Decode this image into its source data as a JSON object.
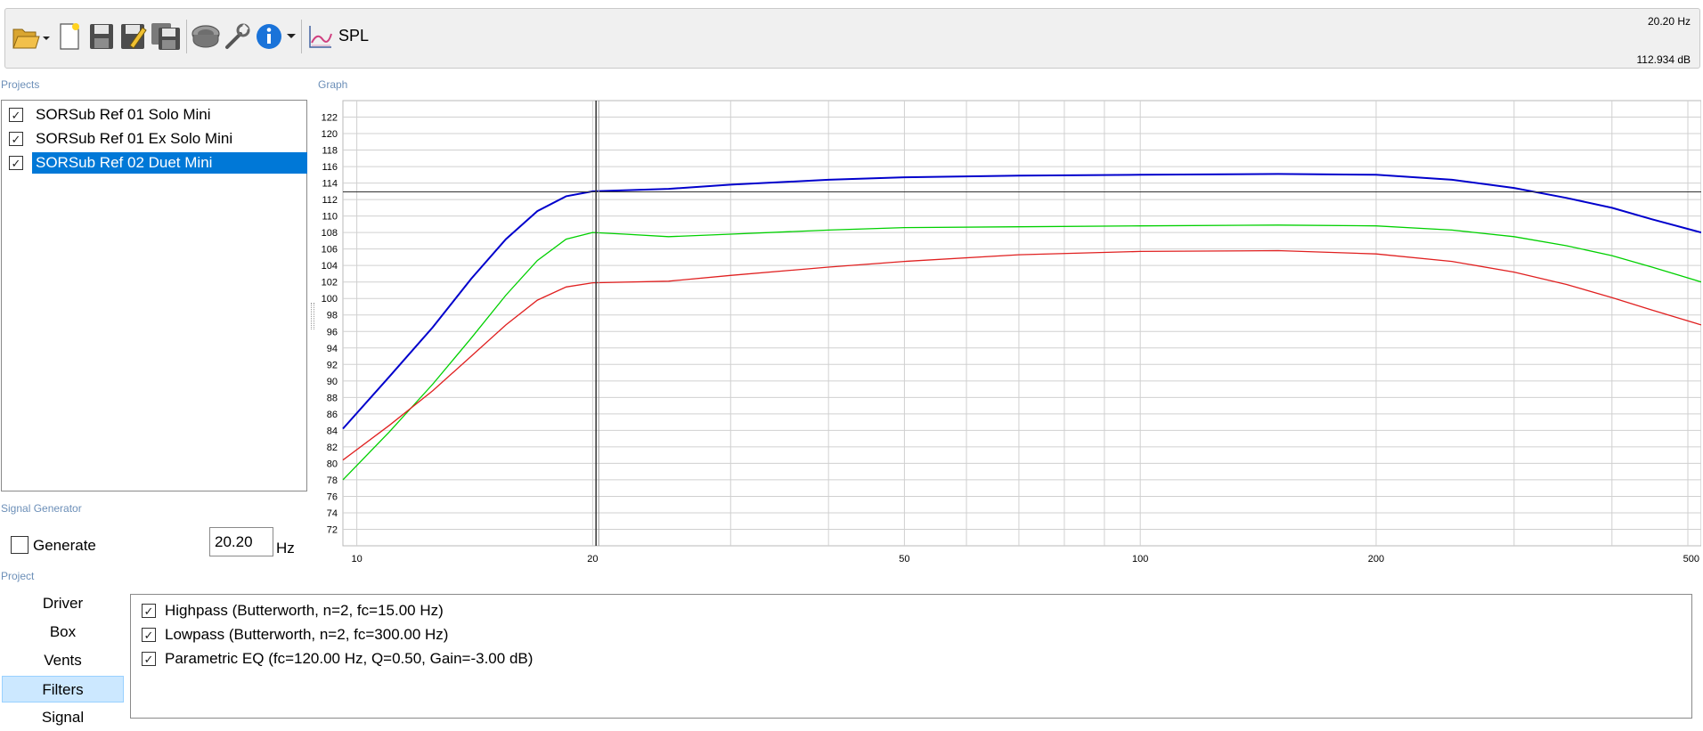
{
  "toolbar": {
    "icons": [
      "folder-open-icon",
      "new-file-icon",
      "save-icon",
      "save-as-icon",
      "save-all-icon",
      "speaker-icon",
      "wrench-icon",
      "info-icon",
      "spl-chart-icon"
    ],
    "spl_label": "SPL",
    "readout_freq": "20.20 Hz",
    "readout_spl": "112.934 dB"
  },
  "projects": {
    "heading": "Projects",
    "items": [
      {
        "label": "SORSub Ref 01 Solo Mini",
        "checked": true,
        "selected": false
      },
      {
        "label": "SORSub Ref 01 Ex Solo Mini",
        "checked": true,
        "selected": false
      },
      {
        "label": "SORSub Ref 02 Duet Mini",
        "checked": true,
        "selected": true
      }
    ]
  },
  "signal_generator": {
    "heading": "Signal Generator",
    "generate_label": "Generate",
    "generate_checked": false,
    "frequency_value": "20.20",
    "unit": "Hz"
  },
  "project": {
    "heading": "Project",
    "nav": [
      "Driver",
      "Box",
      "Vents",
      "Filters",
      "Signal"
    ],
    "active": "Filters"
  },
  "filters": [
    {
      "label": "Highpass (Butterworth, n=2, fc=15.00 Hz)",
      "checked": true
    },
    {
      "label": "Lowpass (Butterworth, n=2, fc=300.00 Hz)",
      "checked": true
    },
    {
      "label": "Parametric EQ (fc=120.00 Hz, Q=0.50, Gain=-3.00 dB)",
      "checked": true
    }
  ],
  "graph": {
    "heading": "Graph"
  },
  "chart_data": {
    "type": "line",
    "xscale": "log",
    "xlim": [
      9.6,
      520
    ],
    "ylim": [
      70,
      124
    ],
    "x_tick_labels": [
      "10",
      "20",
      "50",
      "100",
      "200",
      "500"
    ],
    "y_tick_labels": [
      "72",
      "74",
      "76",
      "78",
      "80",
      "82",
      "84",
      "86",
      "88",
      "90",
      "92",
      "94",
      "96",
      "98",
      "100",
      "102",
      "104",
      "106",
      "108",
      "110",
      "112",
      "114",
      "116",
      "118",
      "120",
      "122"
    ],
    "cursor": {
      "x": 20.2,
      "y": 112.934
    },
    "series": [
      {
        "color": "#0000cc",
        "points": [
          [
            9.6,
            84.2
          ],
          [
            11,
            90.5
          ],
          [
            12.5,
            96.5
          ],
          [
            14,
            102.4
          ],
          [
            15.5,
            107.2
          ],
          [
            17,
            110.6
          ],
          [
            18.5,
            112.4
          ],
          [
            20,
            113.0
          ],
          [
            25,
            113.3
          ],
          [
            30,
            113.8
          ],
          [
            40,
            114.4
          ],
          [
            50,
            114.7
          ],
          [
            70,
            114.9
          ],
          [
            100,
            115.0
          ],
          [
            150,
            115.1
          ],
          [
            200,
            115.0
          ],
          [
            250,
            114.4
          ],
          [
            300,
            113.4
          ],
          [
            350,
            112.2
          ],
          [
            400,
            111.0
          ],
          [
            450,
            109.6
          ],
          [
            520,
            108.0
          ]
        ]
      },
      {
        "color": "#00d000",
        "points": [
          [
            9.6,
            78.0
          ],
          [
            11,
            83.8
          ],
          [
            12.5,
            89.6
          ],
          [
            14,
            95.2
          ],
          [
            15.5,
            100.4
          ],
          [
            17,
            104.6
          ],
          [
            18.5,
            107.2
          ],
          [
            20,
            108.0
          ],
          [
            22,
            107.8
          ],
          [
            25,
            107.5
          ],
          [
            30,
            107.8
          ],
          [
            40,
            108.3
          ],
          [
            50,
            108.6
          ],
          [
            70,
            108.7
          ],
          [
            100,
            108.8
          ],
          [
            150,
            108.9
          ],
          [
            200,
            108.8
          ],
          [
            250,
            108.3
          ],
          [
            300,
            107.5
          ],
          [
            350,
            106.4
          ],
          [
            400,
            105.2
          ],
          [
            450,
            103.8
          ],
          [
            520,
            102.0
          ]
        ]
      },
      {
        "color": "#e02020",
        "points": [
          [
            9.6,
            80.4
          ],
          [
            11,
            84.6
          ],
          [
            12.5,
            88.8
          ],
          [
            14,
            93.0
          ],
          [
            15.5,
            96.8
          ],
          [
            17,
            99.8
          ],
          [
            18.5,
            101.4
          ],
          [
            20,
            101.9
          ],
          [
            25,
            102.1
          ],
          [
            30,
            102.8
          ],
          [
            40,
            103.8
          ],
          [
            50,
            104.5
          ],
          [
            70,
            105.3
          ],
          [
            100,
            105.7
          ],
          [
            150,
            105.8
          ],
          [
            200,
            105.4
          ],
          [
            250,
            104.5
          ],
          [
            300,
            103.2
          ],
          [
            350,
            101.7
          ],
          [
            400,
            100.1
          ],
          [
            450,
            98.6
          ],
          [
            520,
            96.8
          ]
        ]
      }
    ]
  }
}
